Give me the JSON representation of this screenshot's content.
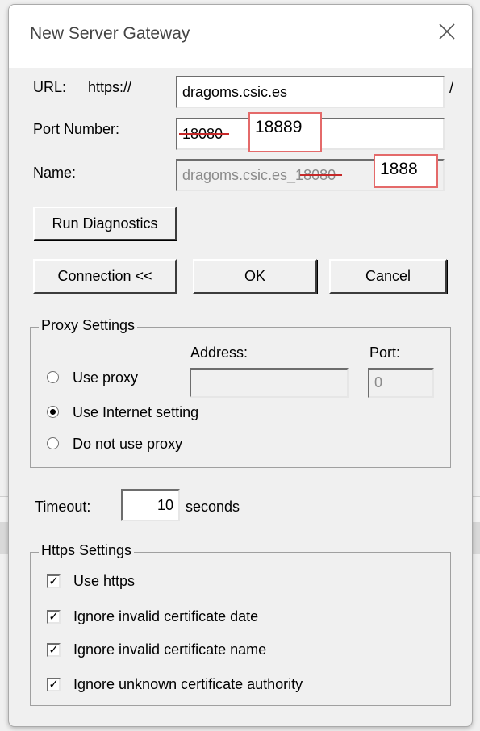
{
  "dialog": {
    "title": "New Server Gateway",
    "close_icon": "close-icon"
  },
  "url": {
    "label": "URL:",
    "prefix": "https://",
    "value": "dragoms.csic.es",
    "suffix": "/"
  },
  "port": {
    "label": "Port Number:",
    "old_value": "18080",
    "new_value": "18889"
  },
  "name": {
    "label": "Name:",
    "value_prefix": "dragoms.csic.es_1",
    "struck_value": "8080",
    "annotation": "1888"
  },
  "buttons": {
    "run_diagnostics": "Run Diagnostics",
    "connection": "Connection <<",
    "ok": "OK",
    "cancel": "Cancel"
  },
  "proxy": {
    "legend": "Proxy Settings",
    "address_label": "Address:",
    "port_label": "Port:",
    "address_value": "",
    "port_value": "0",
    "options": [
      {
        "label": "Use proxy",
        "selected": false
      },
      {
        "label": "Use Internet setting",
        "selected": true
      },
      {
        "label": "Do not use proxy",
        "selected": false
      }
    ]
  },
  "timeout": {
    "label": "Timeout:",
    "value": "10",
    "unit": "seconds"
  },
  "https": {
    "legend": "Https Settings",
    "options": [
      {
        "label": "Use https",
        "checked": true
      },
      {
        "label": "Ignore invalid certificate date",
        "checked": true
      },
      {
        "label": "Ignore invalid certificate name",
        "checked": true
      },
      {
        "label": "Ignore unknown certificate authority",
        "checked": true
      }
    ]
  }
}
